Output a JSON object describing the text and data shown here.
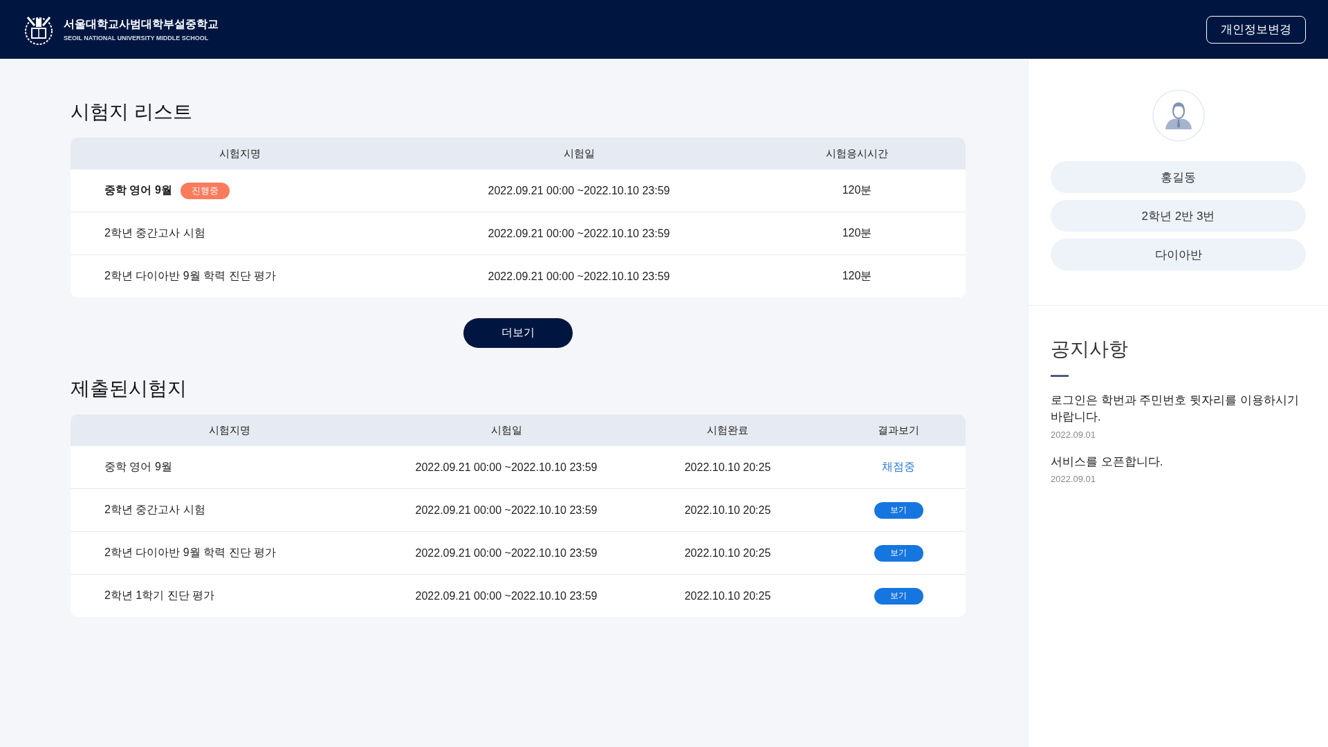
{
  "header": {
    "school_name": "서울대학교사범대학부설중학교",
    "school_name_en": "SEOIL NATIONAL UNIVERSITY MIDDLE SCHOOL",
    "profile_button": "개인정보변경"
  },
  "exam_list": {
    "title": "시험지 리스트",
    "columns": [
      "시험지명",
      "시험일",
      "시험응시시간"
    ],
    "rows": [
      {
        "name": "중학 영어 9월",
        "badge": "진행중",
        "date": "2022.09.21 00:00 ~2022.10.10 23:59",
        "duration": "120분"
      },
      {
        "name": "2학년 중간고사 시험",
        "date": "2022.09.21 00:00 ~2022.10.10 23:59",
        "duration": "120분"
      },
      {
        "name": "2학년 다이아반 9월 학력 진단 평가",
        "date": "2022.09.21 00:00 ~2022.10.10 23:59",
        "duration": "120분"
      }
    ],
    "more_button": "더보기"
  },
  "submitted": {
    "title": "제출된시험지",
    "columns": [
      "시험지명",
      "시험일",
      "시험완료",
      "결과보기"
    ],
    "rows": [
      {
        "name": "중학 영어 9월",
        "date": "2022.09.21 00:00 ~2022.10.10 23:59",
        "completed": "2022.10.10 20:25",
        "result": {
          "kind": "status",
          "text": "채점중"
        }
      },
      {
        "name": "2학년 중간고사 시험",
        "date": "2022.09.21 00:00 ~2022.10.10 23:59",
        "completed": "2022.10.10 20:25",
        "result": {
          "kind": "button",
          "text": "보기"
        }
      },
      {
        "name": "2학년 다이아반 9월 학력 진단 평가",
        "date": "2022.09.21 00:00 ~2022.10.10 23:59",
        "completed": "2022.10.10 20:25",
        "result": {
          "kind": "button",
          "text": "보기"
        }
      },
      {
        "name": "2학년 1학기 진단 평가",
        "date": "2022.09.21 00:00 ~2022.10.10 23:59",
        "completed": "2022.10.10 20:25",
        "result": {
          "kind": "button",
          "text": "보기"
        }
      }
    ]
  },
  "profile": {
    "fields": [
      "홍길동",
      "2학년 2반 3번",
      "다이아반"
    ]
  },
  "notices": {
    "title": "공지사항",
    "items": [
      {
        "text": "로그인은 학번과 주민번호 뒷자리를 이용하시기 바랍니다.",
        "date": "2022.09.01"
      },
      {
        "text": "서비스를 오픈합니다.",
        "date": "2022.09.01"
      }
    ]
  }
}
